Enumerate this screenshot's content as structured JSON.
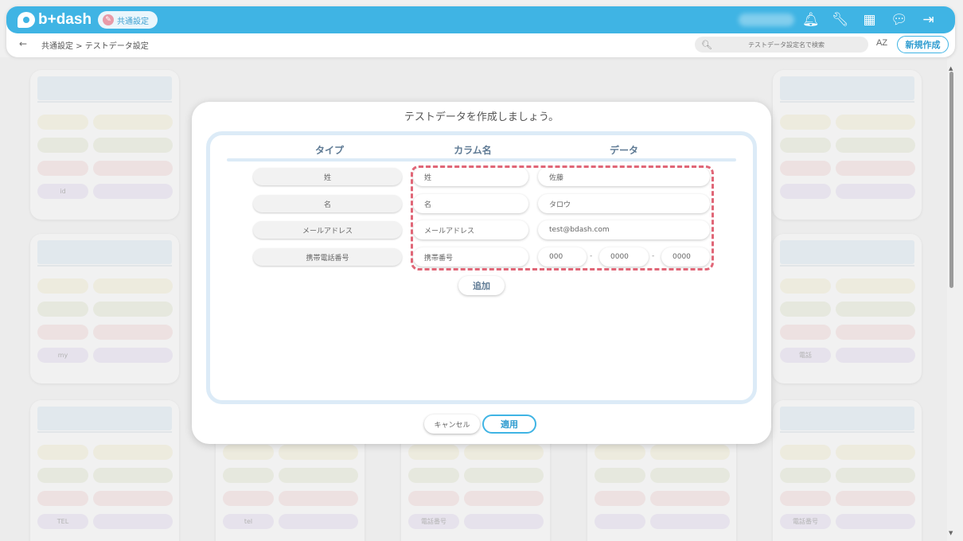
{
  "header": {
    "logo_text": "b+dash",
    "chip_label": "共通設定",
    "icons": [
      "bell-icon",
      "wrench-icon",
      "grid-icon",
      "chat-icon",
      "logout-icon"
    ],
    "accent": "#3fb4e4"
  },
  "breadcrumb": {
    "back": "←",
    "path": "共通設定 > テストデータ設定"
  },
  "search": {
    "placeholder": "テストデータ設定名で検索"
  },
  "sort_label": "AZ",
  "new_button": "新規作成",
  "bg_cards": [
    {
      "col": 0,
      "row": 0,
      "rows": [
        {
          "a": "",
          "b": ""
        },
        {
          "a": "",
          "b": ""
        },
        {
          "a": "",
          "b": ""
        },
        {
          "a": "id",
          "b": ""
        }
      ]
    },
    {
      "col": 0,
      "row": 1,
      "rows": [
        {
          "a": "",
          "b": ""
        },
        {
          "a": "",
          "b": ""
        },
        {
          "a": "",
          "b": ""
        },
        {
          "a": "my",
          "b": ""
        }
      ]
    },
    {
      "col": 0,
      "row": 2,
      "rows": [
        {
          "a": "",
          "b": ""
        },
        {
          "a": "",
          "b": ""
        },
        {
          "a": "",
          "b": ""
        },
        {
          "a": "TEL",
          "b": ""
        }
      ]
    },
    {
      "col": 1,
      "row": 2,
      "rows": [
        {
          "a": "",
          "b": ""
        },
        {
          "a": "",
          "b": ""
        },
        {
          "a": "",
          "b": ""
        },
        {
          "a": "tel",
          "b": ""
        }
      ]
    },
    {
      "col": 2,
      "row": 2,
      "rows": [
        {
          "a": "",
          "b": ""
        },
        {
          "a": "",
          "b": ""
        },
        {
          "a": "",
          "b": ""
        },
        {
          "a": "電話番号",
          "b": ""
        }
      ]
    },
    {
      "col": 3,
      "row": 2,
      "rows": [
        {
          "a": "",
          "b": ""
        },
        {
          "a": "",
          "b": ""
        },
        {
          "a": "",
          "b": ""
        },
        {
          "a": "",
          "b": ""
        }
      ]
    },
    {
      "col": 4,
      "row": 0,
      "rows": [
        {
          "a": "",
          "b": ""
        },
        {
          "a": "",
          "b": ""
        },
        {
          "a": "",
          "b": ""
        },
        {
          "a": "",
          "b": ""
        }
      ]
    },
    {
      "col": 4,
      "row": 1,
      "rows": [
        {
          "a": "",
          "b": ""
        },
        {
          "a": "",
          "b": ""
        },
        {
          "a": "",
          "b": ""
        },
        {
          "a": "電話",
          "b": ""
        }
      ]
    },
    {
      "col": 4,
      "row": 2,
      "rows": [
        {
          "a": "",
          "b": ""
        },
        {
          "a": "",
          "b": ""
        },
        {
          "a": "",
          "b": ""
        },
        {
          "a": "電話番号",
          "b": ""
        }
      ]
    }
  ],
  "modal": {
    "title": "テストデータを作成しましょう。",
    "columns": {
      "type": "タイプ",
      "column_name": "カラム名",
      "data": "データ"
    },
    "rows": [
      {
        "type": "姓",
        "column": "姓",
        "value": "佐藤"
      },
      {
        "type": "名",
        "column": "名",
        "value": "タロウ"
      },
      {
        "type": "メールアドレス",
        "column": "メールアドレス",
        "value": "test@bdash.com"
      },
      {
        "type": "携帯電話番号",
        "column": "携帯番号",
        "phone": [
          "000",
          "0000",
          "0000"
        ],
        "sep": "-"
      }
    ],
    "add_button": "追加",
    "cancel_button": "キャンセル",
    "apply_button": "適用",
    "highlight_color": "#e06677"
  }
}
